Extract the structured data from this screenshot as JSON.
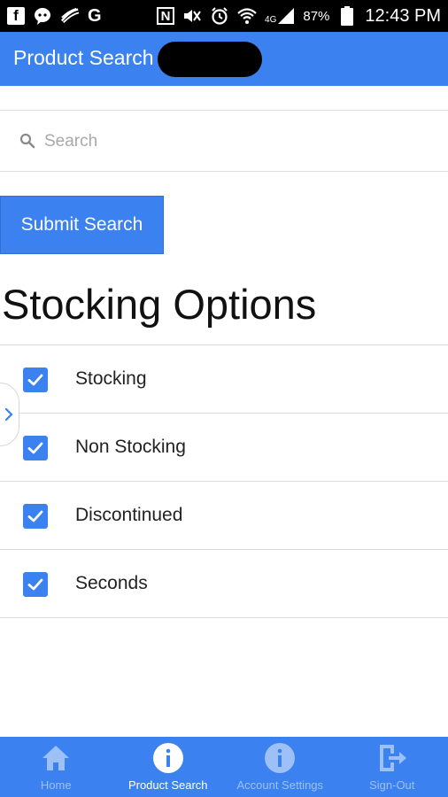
{
  "status_bar": {
    "g_label": "G",
    "n_label": "N",
    "network_label": "4G",
    "battery": "87%",
    "time": "12:43 PM"
  },
  "app_bar": {
    "title": "Product Search"
  },
  "search": {
    "placeholder": "Search",
    "value": ""
  },
  "submit_button": {
    "label": "Submit Search"
  },
  "stocking": {
    "title": "Stocking Options",
    "options": [
      {
        "label": "Stocking",
        "checked": true
      },
      {
        "label": "Non Stocking",
        "checked": true
      },
      {
        "label": "Discontinued",
        "checked": true
      },
      {
        "label": "Seconds",
        "checked": true
      }
    ]
  },
  "bottom_nav": {
    "items": [
      {
        "label": "Home",
        "icon": "home-icon",
        "active": false
      },
      {
        "label": "Product Search",
        "icon": "info-icon",
        "active": true
      },
      {
        "label": "Account Settings",
        "icon": "info-icon",
        "active": false
      },
      {
        "label": "Sign-Out",
        "icon": "sign-out-icon",
        "active": false
      }
    ]
  },
  "colors": {
    "primary": "#3b82f0",
    "inactive_nav": "#9dc0f7"
  }
}
